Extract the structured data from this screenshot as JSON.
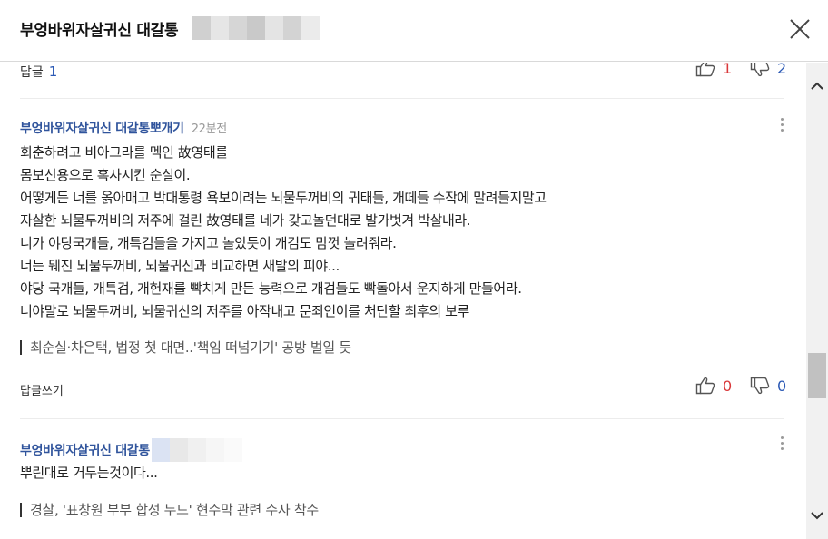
{
  "header": {
    "title": "부엉바위자살귀신 대갈통"
  },
  "colors": {
    "author": "#30549c",
    "upvote": "#d9383a",
    "downvote": "#2b59b5"
  },
  "icons": {
    "close": "close-icon",
    "thumbs_up": "thumbs-up-icon",
    "thumbs_down": "thumbs-down-icon",
    "more": "more-vertical-icon",
    "scroll_up": "chevron-up-icon",
    "scroll_down": "chevron-down-icon"
  },
  "top_reply": {
    "label": "답글",
    "count": "1",
    "up": "1",
    "down": "2"
  },
  "comments": [
    {
      "author": "부엉바위자살귀신 대갈통뽀개기",
      "time": "22분전",
      "lines": [
        "회춘하려고 비아그라를 멕인 故영태를",
        "몸보신용으로 혹사시킨 순실이.",
        "어떻게든 너를 옭아매고 박대통령 욕보이려는 뇌물두꺼비의 귀태들, 개떼들 수작에 말려들지말고",
        "자살한 뇌물두꺼비의 저주에 걸린 故영태를 네가 갖고놀던대로 발가벗겨 박살내라.",
        "니가 야당국개들, 개특검들을 가지고 놀았듯이 개검도 맘껏 놀려줘라.",
        "너는 뒈진 뇌물두꺼비, 뇌물귀신과 비교하면 새발의 피야...",
        "야당 국개들, 개특검, 개헌재를 빡치게 만든 능력으로 개검들도 빡돌아서 운지하게 만들어라.",
        "너야말로 뇌물두꺼비, 뇌물귀신의 저주를 아작내고 문죄인이를 처단할 최후의 보루"
      ],
      "related": "최순실·차은택, 법정 첫 대면..'책임 떠넘기기' 공방 벌일 듯",
      "reply_label": "답글쓰기",
      "up": "0",
      "down": "0"
    },
    {
      "author": "부엉바위자살귀신 대갈통",
      "lines": [
        "뿌린대로 거두는것이다..."
      ],
      "related": "경찰, '표창원 부부 합성 누드' 현수막 관련 수사 착수"
    }
  ]
}
